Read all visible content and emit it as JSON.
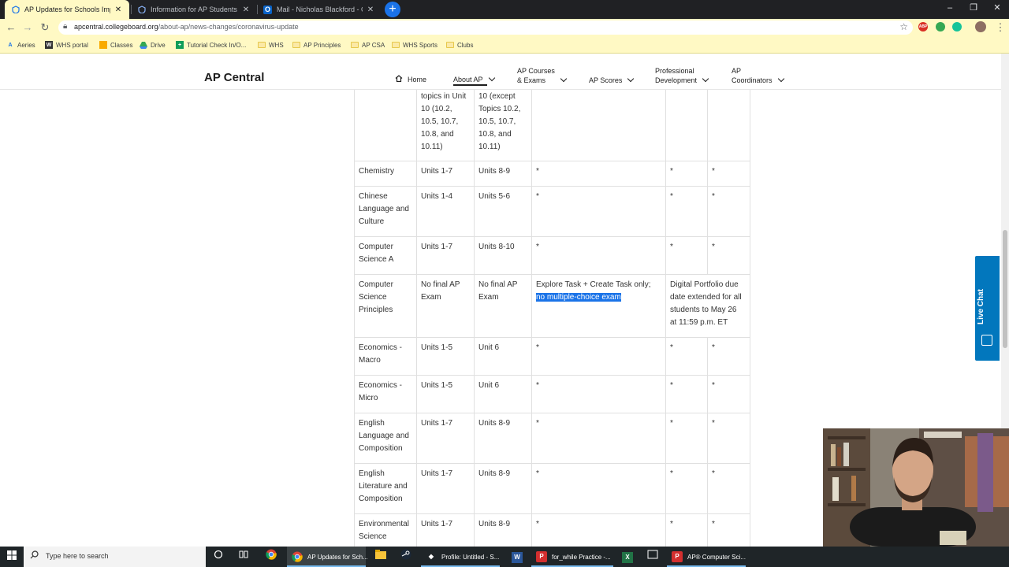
{
  "browser": {
    "tabs": [
      {
        "title": "AP Updates for Schools Impacte",
        "close": "✕"
      },
      {
        "title": "Information for AP Students Affe",
        "close": "✕"
      },
      {
        "title": "Mail - Nicholas Blackford - Outlo",
        "close": "✕"
      }
    ],
    "new_tab": "+",
    "window_controls": {
      "minimize": "–",
      "maximize": "❐",
      "close": "✕"
    },
    "url_host": "apcentral.collegeboard.org",
    "url_path": "/about-ap/news-changes/coronavirus-update",
    "bookmarks": [
      "Aeries",
      "WHS portal",
      "Classes",
      "Drive",
      "Tutorial Check In/O...",
      "WHS",
      "AP Principles",
      "AP CSA",
      "WHS Sports",
      "Clubs"
    ],
    "extension_badges": [
      "ABP"
    ]
  },
  "site": {
    "brand": "AP Central",
    "nav": [
      {
        "label": "Home"
      },
      {
        "label": "About AP"
      },
      {
        "line1": "AP Courses",
        "line2": "& Exams"
      },
      {
        "label": "AP Scores"
      },
      {
        "line1": "Professional",
        "line2": "Development"
      },
      {
        "line1": "AP",
        "line2": "Coordinators"
      }
    ]
  },
  "table": {
    "partial_row": {
      "col2": "topics in Unit 10 (10.2, 10.5, 10.7, 10.8, and 10.11)",
      "col3": "10 (except Topics 10.2, 10.5, 10.7, 10.8, and 10.11)"
    },
    "rows": [
      {
        "subject": "Chemistry",
        "included": "Units 1-7",
        "excluded": "Units 8-9",
        "notes": "*",
        "c5": "*",
        "c6": "*"
      },
      {
        "subject": "Chinese Language and Culture",
        "included": "Units 1-4",
        "excluded": "Units 5-6",
        "notes": "*",
        "c5": "*",
        "c6": "*"
      },
      {
        "subject": "Computer Science A",
        "included": "Units 1-7",
        "excluded": "Units 8-10",
        "notes": "*",
        "c5": "*",
        "c6": "*"
      },
      {
        "subject": "Computer Science Principles",
        "included": "No final AP Exam",
        "excluded": "No final AP Exam",
        "notes": "Explore Task + Create Task only;",
        "notes_highlight": "no multiple-choice exam",
        "c5": "Digital Portfolio due date extended for all students to May 26 at 11:59 p.m. ET",
        "c6": ""
      },
      {
        "subject": "Economics - Macro",
        "included": "Units 1-5",
        "excluded": "Unit 6",
        "notes": "*",
        "c5": "*",
        "c6": "*"
      },
      {
        "subject": "Economics - Micro",
        "included": "Units 1-5",
        "excluded": "Unit 6",
        "notes": "*",
        "c5": "*",
        "c6": "*"
      },
      {
        "subject": "English Language and Composition",
        "included": "Units 1-7",
        "excluded": "Units 8-9",
        "notes": "*",
        "c5": "*",
        "c6": "*"
      },
      {
        "subject": "English Literature and Composition",
        "included": "Units 1-7",
        "excluded": "Units 8-9",
        "notes": "*",
        "c5": "*",
        "c6": "*"
      },
      {
        "subject": "Environmental Science",
        "included": "Units 1-7",
        "excluded": "Units 8-9",
        "notes": "*",
        "c5": "*",
        "c6": "*"
      }
    ]
  },
  "live_chat": {
    "label": "Live Chat"
  },
  "taskbar": {
    "search_placeholder": "Type here to search",
    "apps": [
      {
        "label": "AP Updates for Sch..."
      },
      {
        "label": "Profile: Untitled - S..."
      },
      {
        "label": "for_while Practice -..."
      },
      {
        "label": "AP® Computer Sci..."
      }
    ]
  },
  "colors": {
    "chrome_yellow": "#fff9c4",
    "selection_blue": "#1a73e8",
    "live_chat_blue": "#0277bd",
    "taskbar": "#1f2528"
  },
  "icons": [
    "chrome-icon",
    "search-icon",
    "star-icon",
    "lock-icon",
    "home-icon",
    "chevron-down-icon",
    "windows-start-icon",
    "cortana-icon",
    "task-view-icon",
    "file-explorer-icon",
    "steam-icon",
    "word-icon",
    "excel-icon",
    "pdf-icon"
  ]
}
